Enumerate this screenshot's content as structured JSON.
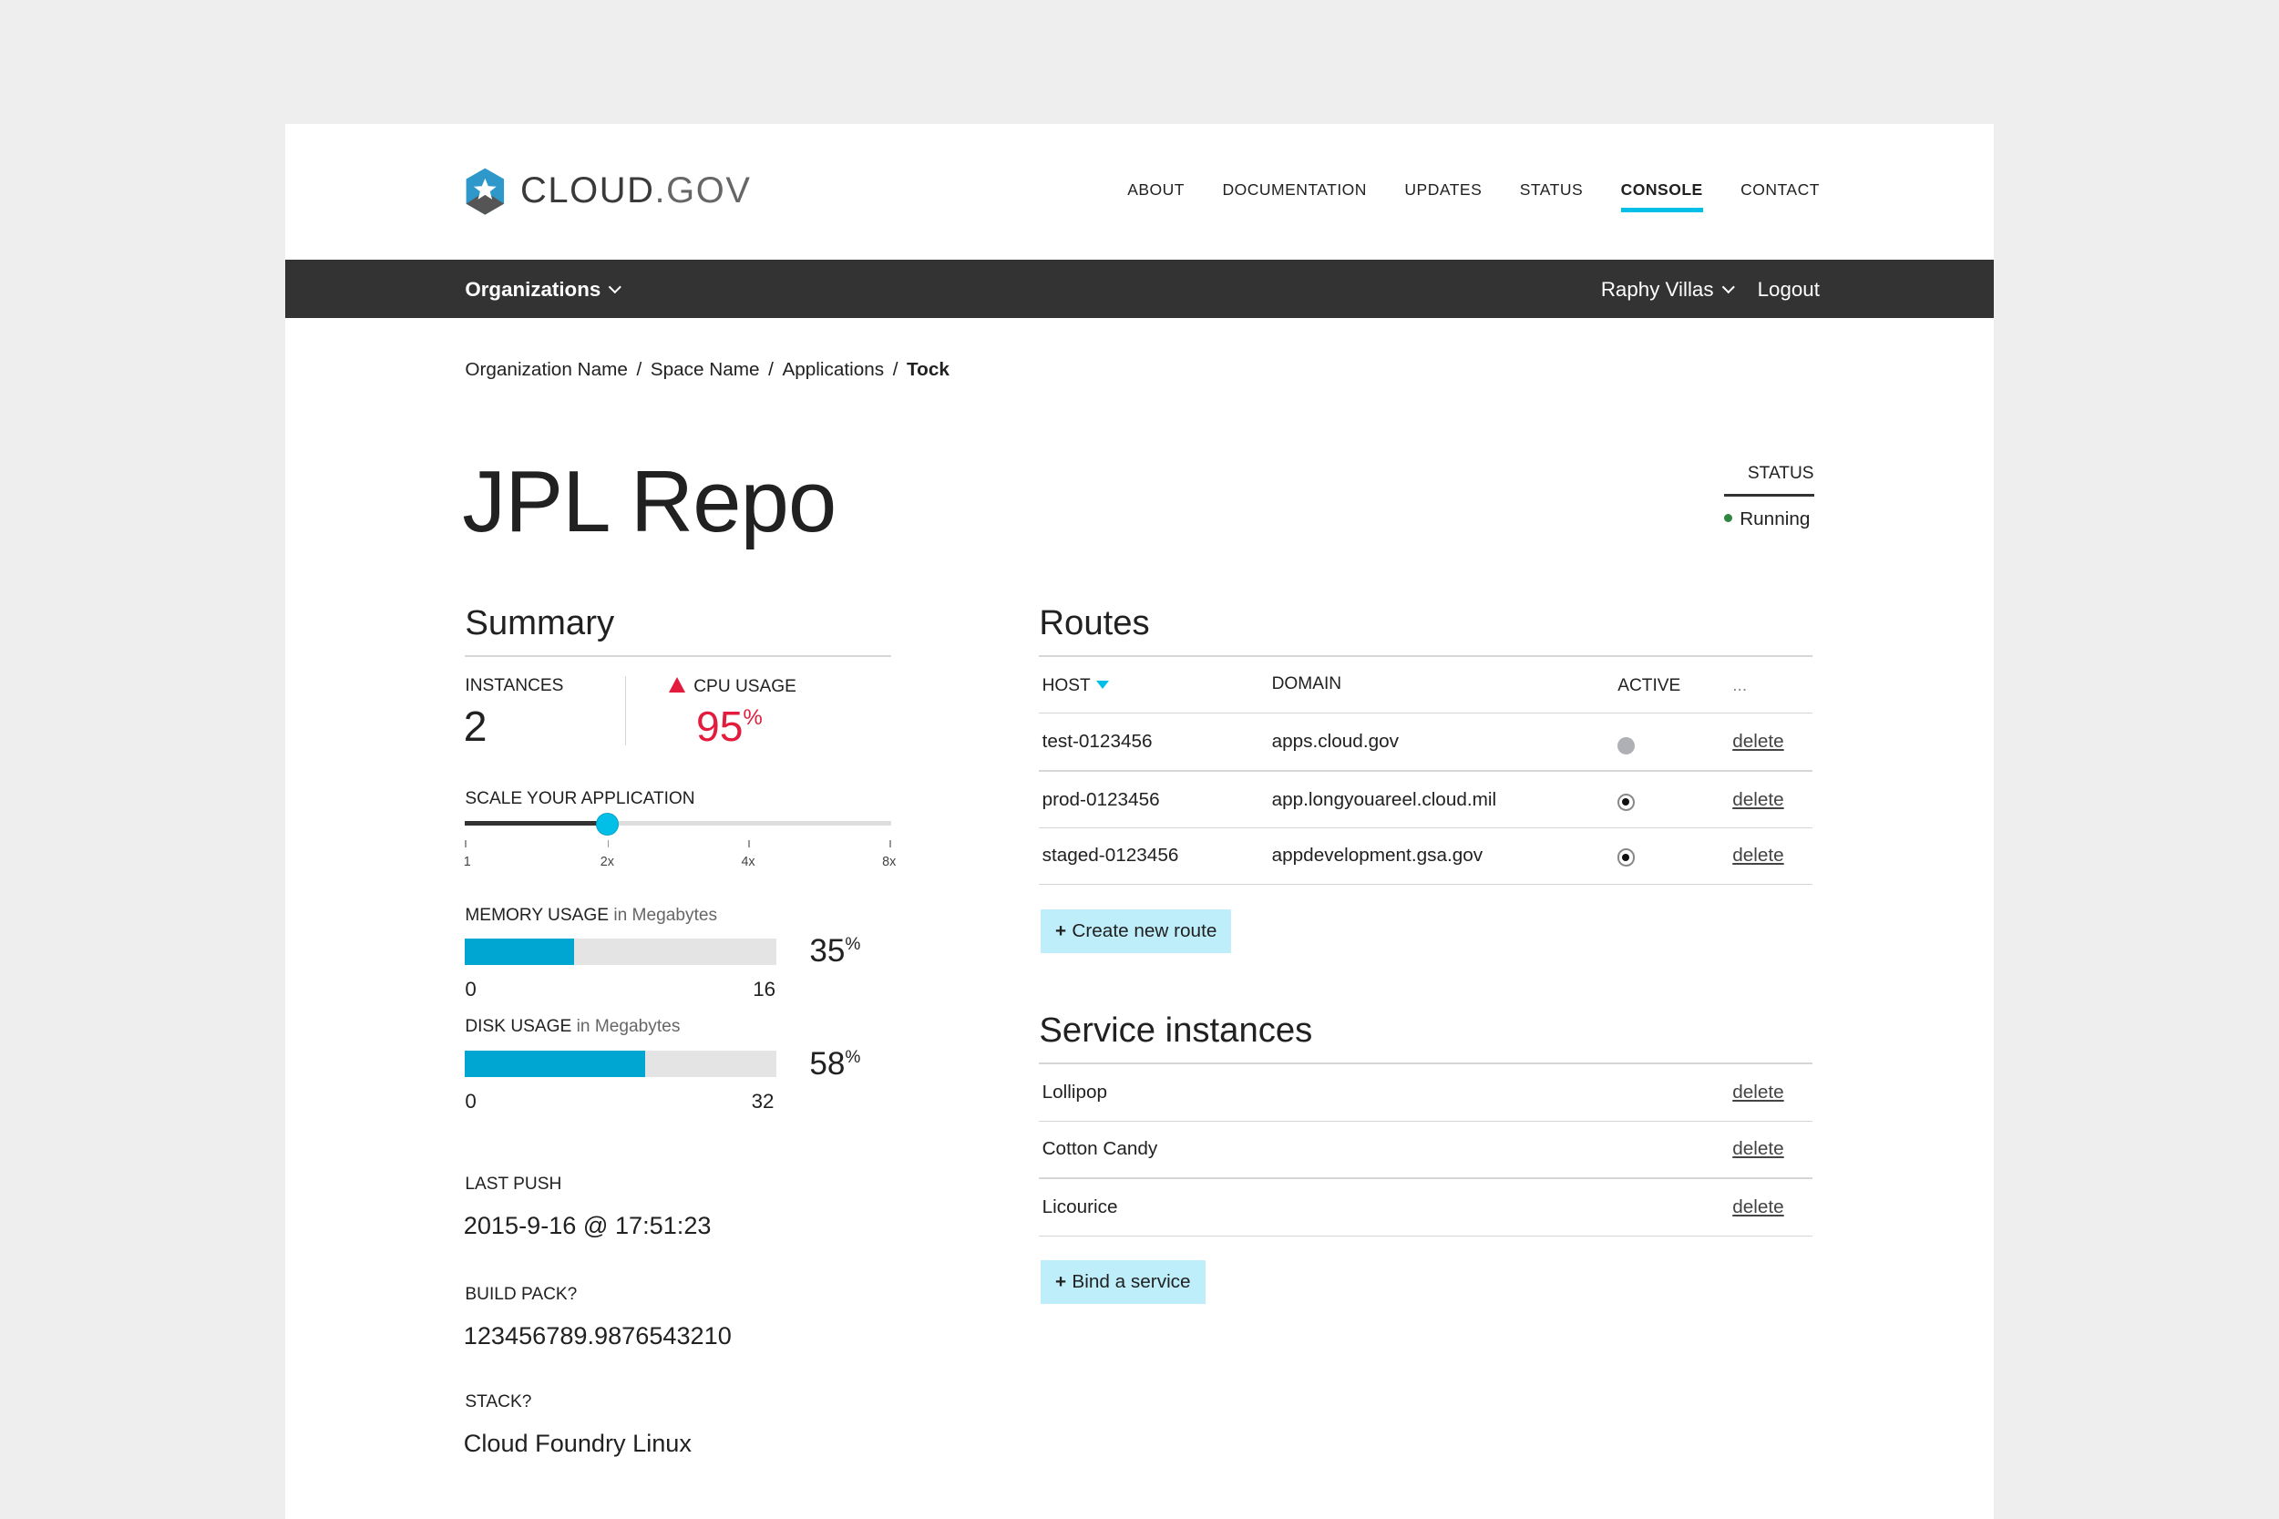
{
  "brand": {
    "logo_text_1": "CLOUD",
    "logo_text_2": ".GOV",
    "logo_icon": "star-hexagon-icon"
  },
  "topnav": [
    {
      "label": "ABOUT"
    },
    {
      "label": "DOCUMENTATION"
    },
    {
      "label": "UPDATES"
    },
    {
      "label": "STATUS"
    },
    {
      "label": "CONSOLE",
      "active": true
    },
    {
      "label": "CONTACT"
    }
  ],
  "orgbar": {
    "organizations": "Organizations",
    "user": "Raphy Villas",
    "logout": "Logout"
  },
  "breadcrumb": [
    "Organization Name",
    "Space Name",
    "Applications",
    "Tock"
  ],
  "app": {
    "title": "JPL Repo",
    "status_label": "STATUS",
    "status_value": "Running"
  },
  "summary": {
    "heading": "Summary",
    "instances_label": "INSTANCES",
    "instances_value": "2",
    "cpu_label": "CPU USAGE",
    "cpu_value": "95",
    "cpu_unit": "%",
    "scale_label": "SCALE YOUR APPLICATION",
    "scale_ticks": [
      "1",
      "2x",
      "4x",
      "8x"
    ],
    "scale_value": "2x",
    "memory": {
      "label": "MEMORY USAGE",
      "unit_label": "in Megabytes",
      "percent": "35",
      "pct_unit": "%",
      "min": "0",
      "max": "16",
      "fill_fraction": 0.35
    },
    "disk": {
      "label": "DISK USAGE",
      "unit_label": "in Megabytes",
      "percent": "58",
      "pct_unit": "%",
      "min": "0",
      "max": "32",
      "fill_fraction": 0.58
    },
    "last_push_label": "LAST PUSH",
    "last_push_value": "2015-9-16 @ 17:51:23",
    "build_pack_label": "BUILD PACK?",
    "build_pack_value": "123456789.9876543210",
    "stack_label": "STACK?",
    "stack_value": "Cloud Foundry Linux"
  },
  "routes": {
    "heading": "Routes",
    "columns": {
      "host": "HOST",
      "domain": "DOMAIN",
      "active": "ACTIVE",
      "more": "..."
    },
    "rows": [
      {
        "host": "test-0123456",
        "domain": "apps.cloud.gov",
        "active": false,
        "action": "delete"
      },
      {
        "host": "prod-0123456",
        "domain": "app.longyouareel.cloud.mil",
        "active": true,
        "action": "delete"
      },
      {
        "host": "staged-0123456",
        "domain": "appdevelopment.gsa.gov",
        "active": true,
        "action": "delete"
      }
    ],
    "create_button": "Create new route"
  },
  "services": {
    "heading": "Service instances",
    "rows": [
      {
        "name": "Lollipop",
        "action": "delete"
      },
      {
        "name": "Cotton Candy",
        "action": "delete"
      },
      {
        "name": "Licourice",
        "action": "delete"
      }
    ],
    "bind_button": "Bind a service"
  },
  "colors": {
    "accent": "#02bfe7",
    "bar_fill": "#00a6d2",
    "warning": "#e31c3d",
    "running": "#2e8540",
    "dark_bar": "#333333",
    "button_bg": "#bdeefa"
  }
}
